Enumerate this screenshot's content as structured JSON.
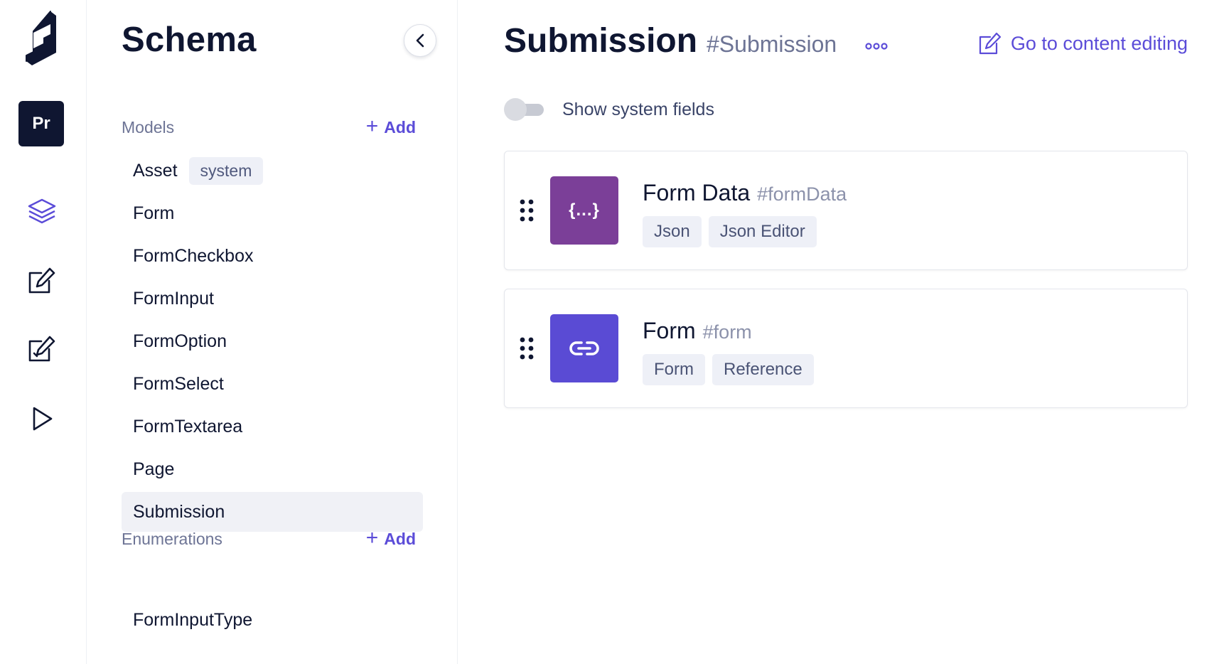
{
  "rail": {
    "project_initials": "Pr",
    "icons": [
      "logo-icon",
      "layers-icon",
      "edit-icon",
      "edit-check-icon",
      "play-icon"
    ]
  },
  "sidebar": {
    "title": "Schema",
    "models_label": "Models",
    "models_add": "Add",
    "models": [
      {
        "name": "Asset",
        "badge": "system"
      },
      {
        "name": "Form"
      },
      {
        "name": "FormCheckbox"
      },
      {
        "name": "FormInput"
      },
      {
        "name": "FormOption"
      },
      {
        "name": "FormSelect"
      },
      {
        "name": "FormTextarea"
      },
      {
        "name": "Page"
      },
      {
        "name": "Submission",
        "active": true
      }
    ],
    "enumerations_label": "Enumerations",
    "enumerations_add": "Add",
    "enumerations": [
      {
        "name": "FormInputType"
      }
    ]
  },
  "main": {
    "title": "Submission",
    "api_id": "#Submission",
    "goto_label": "Go to content editing",
    "show_system_fields_label": "Show system fields",
    "show_system_fields_on": false,
    "fields": [
      {
        "name": "Form Data",
        "api_id": "#formData",
        "icon": "json-braces-icon",
        "icon_text": "{...}",
        "icon_color": "#7b3f98",
        "tags": [
          "Json",
          "Json Editor"
        ]
      },
      {
        "name": "Form",
        "api_id": "#form",
        "icon": "link-icon",
        "icon_color": "#5a4bd4",
        "tags": [
          "Form",
          "Reference"
        ]
      }
    ]
  },
  "colors": {
    "accent": "#5b4cd8",
    "dark": "#0f1631",
    "muted": "#6d7495"
  }
}
